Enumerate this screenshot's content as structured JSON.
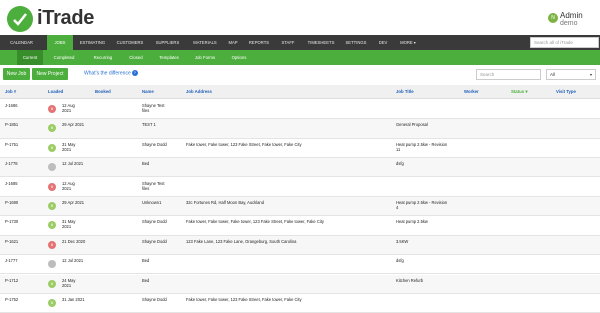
{
  "brand": {
    "name": "iTrade"
  },
  "user": {
    "initials": "N",
    "name": "Admin",
    "role": "demo"
  },
  "nav": {
    "items": [
      "CALENDAR",
      "JOBS",
      "ESTIMATING",
      "CUSTOMERS",
      "SUPPLIERS",
      "MATERIALS",
      "MAP",
      "REPORTS",
      "STAFF",
      "TIMESHEETS",
      "SETTINGS",
      "DEV",
      "MORE ▾"
    ],
    "search_placeholder": "Search all of iTrade"
  },
  "subnav": {
    "items": [
      "Current",
      "Completed",
      "Recurring",
      "Closed",
      "Templates",
      "Job Forms",
      "Options"
    ]
  },
  "toolbar": {
    "new_job": "New Job",
    "new_project": "New Project",
    "difference_link": "What's the difference",
    "help_icon": "?",
    "search_placeholder": "Search",
    "filter_value": "All"
  },
  "table": {
    "columns": {
      "job": "Job #",
      "loaded": "Loaded",
      "booked": "Booked",
      "name": "Name",
      "address": "Job Address",
      "title": "Job Title",
      "worker": "Worker",
      "status": "Status ▾",
      "visit": "Visit Type"
    },
    "rows": [
      {
        "job": "J-1686",
        "initials": "N",
        "avatar": "#e57373",
        "loaded": [
          "12 Aug",
          "2021"
        ],
        "name": [
          "Shayne Test",
          "files"
        ],
        "address": "",
        "title": [
          ""
        ]
      },
      {
        "job": "P-1851",
        "initials": "N",
        "avatar": "#9ccc65",
        "loaded": [
          "29 Apr 2021",
          ""
        ],
        "name": [
          "TEST 1",
          ""
        ],
        "address": "",
        "title": [
          "General Proposal"
        ]
      },
      {
        "job": "P-1751",
        "initials": "N",
        "avatar": "#9ccc65",
        "loaded": [
          "31 May",
          "2021"
        ],
        "name": [
          "Shayne Dodd",
          ""
        ],
        "address": "Fake tower, Fake tower, 123 Fake Street, Fake tower, Fake City",
        "title": [
          "Heat pump 2.5kw - Revision",
          "11"
        ]
      },
      {
        "job": "J-1778",
        "initials": "",
        "avatar": "#bdbdbd",
        "loaded": [
          "12 Jul 2021",
          ""
        ],
        "name": [
          "Bed",
          ""
        ],
        "address": "",
        "title": [
          "dsfg"
        ]
      },
      {
        "job": "J-1685",
        "initials": "N",
        "avatar": "#e57373",
        "loaded": [
          "12 Aug",
          "2021"
        ],
        "name": [
          "Shayne Test",
          "files"
        ],
        "address": "",
        "title": [
          ""
        ]
      },
      {
        "job": "P-1690",
        "initials": "N",
        "avatar": "#9ccc65",
        "loaded": [
          "29 Apr 2021",
          ""
        ],
        "name": [
          "Unknown1",
          ""
        ],
        "address": "32c Fortunes Rd, Half Moon Bay, Auckland",
        "title": [
          "Heat pump 2.5kw - Revision",
          "4"
        ]
      },
      {
        "job": "P-1730",
        "initials": "N",
        "avatar": "#9ccc65",
        "loaded": [
          "31 May",
          "2021"
        ],
        "name": [
          "Shayne Dodd",
          ""
        ],
        "address": "Fake tower, Fake tower, Fake tower, 123 Fake Street, Fake tower, Fake City",
        "title": [
          "Heat pump 2.5kw",
          ""
        ]
      },
      {
        "job": "P-1621",
        "initials": "N",
        "avatar": "#e57373",
        "loaded": [
          "21 Dec 2020",
          ""
        ],
        "name": [
          "Shayne Dodd",
          ""
        ],
        "address": "123 Fake Lane, 123 Fake Lane, Orangeburg, South Carolina",
        "title": [
          "3.5KW"
        ]
      },
      {
        "job": "J-1777",
        "initials": "",
        "avatar": "#bdbdbd",
        "loaded": [
          "12 Jul 2021",
          ""
        ],
        "name": [
          "Bed",
          ""
        ],
        "address": "",
        "title": [
          "dsfg"
        ]
      },
      {
        "job": "P-1712",
        "initials": "N",
        "avatar": "#9ccc65",
        "loaded": [
          "24 May",
          "2021"
        ],
        "name": [
          "Bed",
          ""
        ],
        "address": "",
        "title": [
          "Kitchen Refurb"
        ]
      },
      {
        "job": "P-1752",
        "initials": "N",
        "avatar": "#9ccc65",
        "loaded": [
          "31 Jan 2021",
          ""
        ],
        "name": [
          "Shayne Dodd",
          ""
        ],
        "address": "Fake tower, Fake tower, 123 Fake Street, Fake tower, Fake City",
        "title": [
          ""
        ]
      }
    ]
  }
}
